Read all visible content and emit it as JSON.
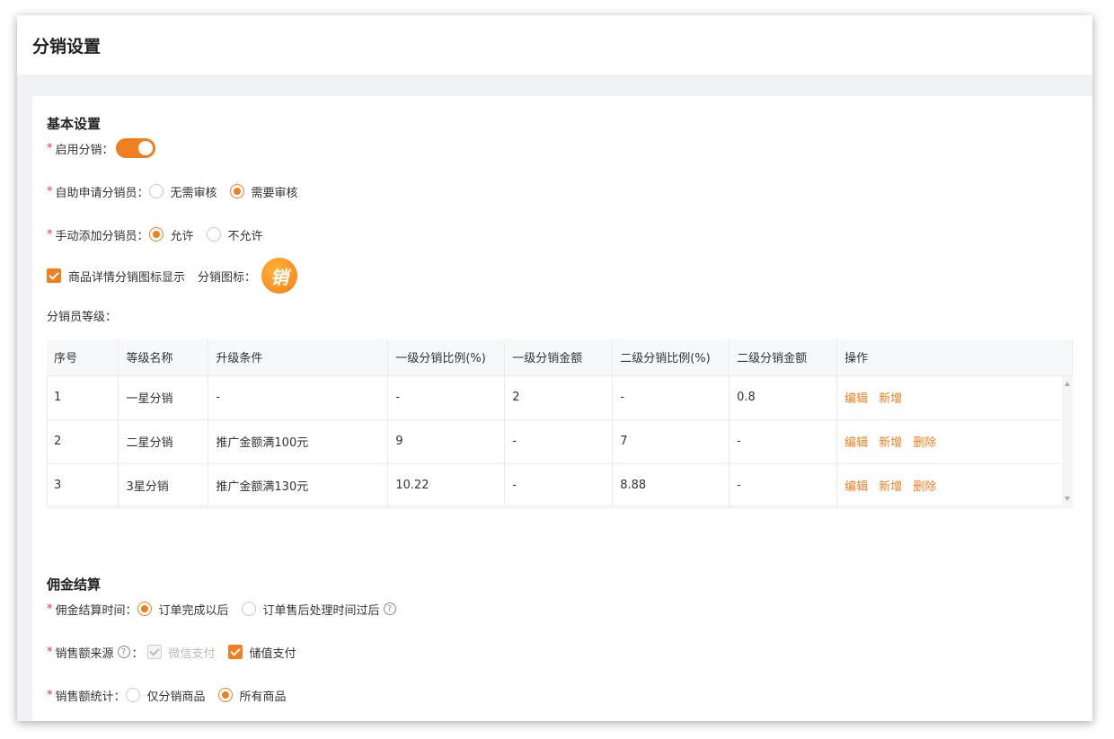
{
  "page_title": "分销设置",
  "basic": {
    "title": "基本设置",
    "enable_label": "启用分销：",
    "self_apply_label": "自助申请分销员：",
    "self_apply_opt1": "无需审核",
    "self_apply_opt2": "需要审核",
    "manual_add_label": "手动添加分销员：",
    "manual_opt1": "允许",
    "manual_opt2": "不允许",
    "detail_icon_check": "商品详情分销图标显示",
    "icon_label": "分销图标：",
    "icon_char": "销",
    "level_label": "分销员等级："
  },
  "table": {
    "headers": [
      "序号",
      "等级名称",
      "升级条件",
      "一级分销比例(%)",
      "一级分销金额",
      "二级分销比例(%)",
      "二级分销金额",
      "操作"
    ],
    "rows": [
      {
        "no": "1",
        "name": "一星分销",
        "cond": "-",
        "r1": "-",
        "a1": "2",
        "r2": "-",
        "a2": "0.8",
        "edit": "编辑",
        "add": "新增",
        "del": ""
      },
      {
        "no": "2",
        "name": "二星分销",
        "cond": "推广金额满100元",
        "r1": "9",
        "a1": "-",
        "r2": "7",
        "a2": "-",
        "edit": "编辑",
        "add": "新增",
        "del": "删除"
      },
      {
        "no": "3",
        "name": "3星分销",
        "cond": "推广金额满130元",
        "r1": "10.22",
        "a1": "-",
        "r2": "8.88",
        "a2": "-",
        "edit": "编辑",
        "add": "新增",
        "del": "删除"
      }
    ]
  },
  "commission": {
    "title": "佣金结算",
    "time_label": "佣金结算时间：",
    "time_opt1": "订单完成以后",
    "time_opt2": "订单售后处理时间过后",
    "source_label": "销售额来源",
    "source_colon": "：",
    "source_opt1": "微信支付",
    "source_opt2": "储值支付",
    "stat_label": "销售额统计：",
    "stat_opt1": "仅分销商品",
    "stat_opt2": "所有商品"
  },
  "colors": {
    "accent": "#f07f1f",
    "required": "#e4393c"
  }
}
